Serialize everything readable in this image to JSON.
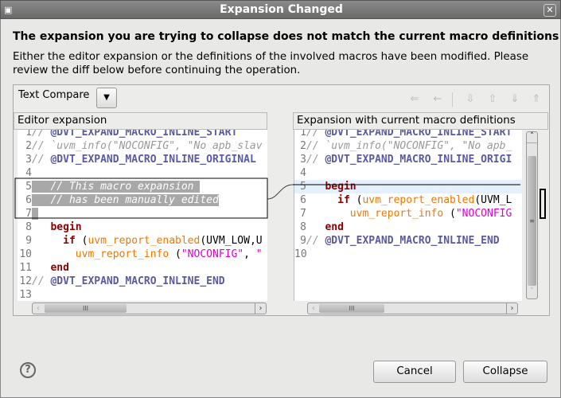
{
  "window": {
    "title": "Expansion Changed",
    "close_icon": "close-icon",
    "app_icon": "dialog-icon"
  },
  "heading": "The expansion you are trying to collapse does not match the current macro definitions",
  "description": [
    "Either the editor expansion or the definitions of the involved macros have been modified. Please",
    "review the diff below before continuing the operation."
  ],
  "compare": {
    "label": "Text Compare",
    "dropdown_icon": "triangle-down-icon",
    "toolbar_icons": [
      "copy-all-left-icon",
      "copy-left-icon",
      "next-diff-icon",
      "prev-diff-icon",
      "next-change-icon",
      "prev-change-icon"
    ]
  },
  "left_pane": {
    "title": "Editor expansion",
    "lines": [
      [
        {
          "t": "// ",
          "c": "cm"
        },
        {
          "t": "@DVT_EXPAND_MACRO_INLINE_START",
          "c": "dir"
        }
      ],
      [
        {
          "t": "// `uvm_info(\"NOCONFIG\", \"No apb_slav",
          "c": "cm"
        }
      ],
      [
        {
          "t": "// ",
          "c": "cm"
        },
        {
          "t": "@DVT_EXPAND_MACRO_INLINE_ORIGINAL",
          "c": "dir"
        }
      ],
      [],
      [
        {
          "t": "   // This macro expansion ",
          "c": "cm"
        }
      ],
      [
        {
          "t": "   // has been manually edited",
          "c": "cm"
        }
      ],
      [
        {
          "t": " ",
          "c": ""
        }
      ],
      [
        {
          "t": "   ",
          "c": ""
        },
        {
          "t": "begin",
          "c": "kw"
        }
      ],
      [
        {
          "t": "     ",
          "c": ""
        },
        {
          "t": "if",
          "c": "kw"
        },
        {
          "t": " (",
          "c": ""
        },
        {
          "t": "uvm_report_enabled",
          "c": "fn"
        },
        {
          "t": "(UVM_LOW,U",
          "c": ""
        }
      ],
      [
        {
          "t": "       ",
          "c": ""
        },
        {
          "t": "uvm_report_info",
          "c": "fn"
        },
        {
          "t": " (",
          "c": ""
        },
        {
          "t": "\"NOCONFIG\"",
          "c": "st"
        },
        {
          "t": ", ",
          "c": ""
        },
        {
          "t": "\"",
          "c": "st"
        }
      ],
      [
        {
          "t": "   ",
          "c": ""
        },
        {
          "t": "end",
          "c": "kw"
        }
      ],
      [
        {
          "t": "// ",
          "c": "cm"
        },
        {
          "t": "@DVT_EXPAND_MACRO_INLINE_END",
          "c": "dir"
        }
      ],
      []
    ]
  },
  "right_pane": {
    "title": "Expansion with current macro definitions",
    "lines": [
      [
        {
          "t": "// ",
          "c": "cm"
        },
        {
          "t": "@DVT_EXPAND_MACRO_INLINE_START",
          "c": "dir"
        }
      ],
      [
        {
          "t": "// `uvm_info(\"NOCONFIG\", \"No apb_",
          "c": "cm"
        }
      ],
      [
        {
          "t": "// ",
          "c": "cm"
        },
        {
          "t": "@DVT_EXPAND_MACRO_INLINE_ORIGI",
          "c": "dir"
        }
      ],
      [],
      [
        {
          "t": "   ",
          "c": ""
        },
        {
          "t": "begin",
          "c": "kw"
        }
      ],
      [
        {
          "t": "     ",
          "c": ""
        },
        {
          "t": "if",
          "c": "kw"
        },
        {
          "t": " (",
          "c": ""
        },
        {
          "t": "uvm_report_enabled",
          "c": "fn"
        },
        {
          "t": "(UVM_L",
          "c": ""
        }
      ],
      [
        {
          "t": "       ",
          "c": ""
        },
        {
          "t": "uvm_report_info",
          "c": "fn"
        },
        {
          "t": " (",
          "c": ""
        },
        {
          "t": "\"NOCONFIG",
          "c": "st"
        }
      ],
      [
        {
          "t": "   ",
          "c": ""
        },
        {
          "t": "end",
          "c": "kw"
        }
      ],
      [
        {
          "t": "// ",
          "c": "cm"
        },
        {
          "t": "@DVT_EXPAND_MACRO_INLINE_END",
          "c": "dir"
        }
      ],
      []
    ]
  },
  "buttons": {
    "cancel": "Cancel",
    "collapse": "Collapse",
    "help_icon": "help-icon"
  },
  "colors": {
    "comment": "#999999",
    "directive": "#5a5a9e",
    "keyword": "#8b0000",
    "function": "#f07800",
    "string": "#e000d0",
    "diff_highlight": "#a8a8a8",
    "current_line": "#e6f0fc"
  }
}
